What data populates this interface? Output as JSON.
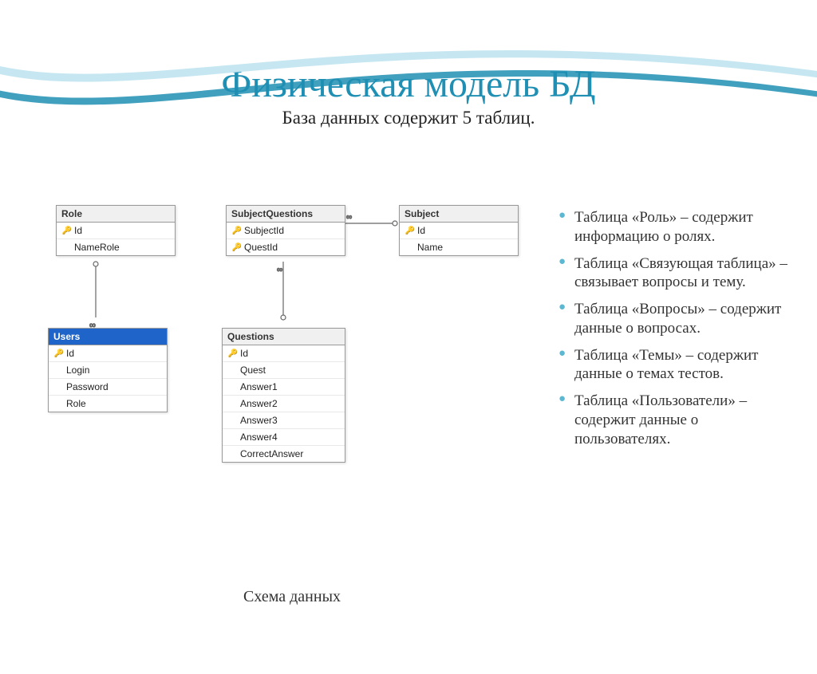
{
  "title": "Физическая модель БД",
  "subtitle": "База данных содержит 5 таблиц.",
  "caption": "Схема данных",
  "tables": {
    "role": {
      "name": "Role",
      "fields": [
        "Id",
        "NameRole"
      ],
      "pk": [
        true,
        false
      ]
    },
    "subjectQuestions": {
      "name": "SubjectQuestions",
      "fields": [
        "SubjectId",
        "QuestId"
      ],
      "pk": [
        true,
        true
      ]
    },
    "subject": {
      "name": "Subject",
      "fields": [
        "Id",
        "Name"
      ],
      "pk": [
        true,
        false
      ]
    },
    "users": {
      "name": "Users",
      "fields": [
        "Id",
        "Login",
        "Password",
        "Role"
      ],
      "pk": [
        true,
        false,
        false,
        false
      ]
    },
    "questions": {
      "name": "Questions",
      "fields": [
        "Id",
        "Quest",
        "Answer1",
        "Answer2",
        "Answer3",
        "Answer4",
        "CorrectAnswer"
      ],
      "pk": [
        true,
        false,
        false,
        false,
        false,
        false,
        false
      ]
    }
  },
  "bullets": [
    "Таблица «Роль» – содержит информацию о ролях.",
    "Таблица «Связующая таблица» – связывает вопросы и тему.",
    "Таблица «Вопросы» – содержит данные о вопросах.",
    "Таблица «Темы» – содержит данные о темах тестов.",
    "Таблица «Пользователи» – содержит данные о пользователях."
  ]
}
